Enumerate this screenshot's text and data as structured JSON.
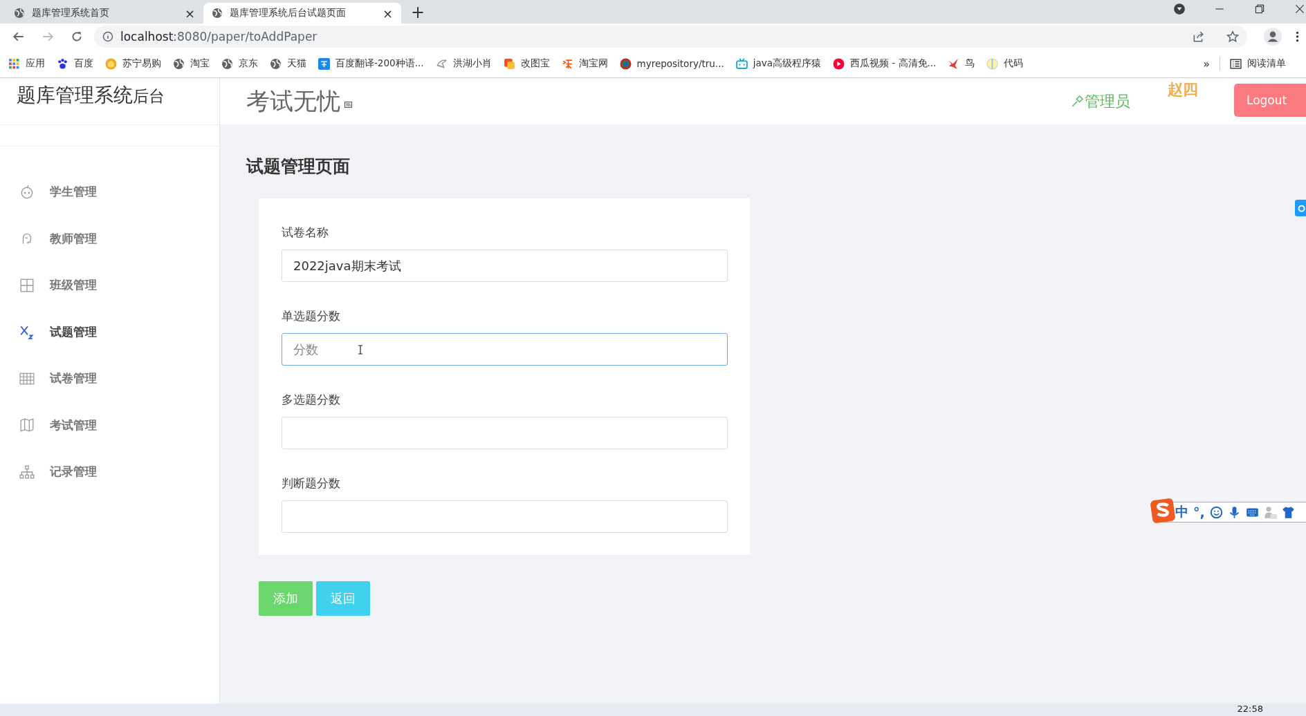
{
  "browser": {
    "tabs": [
      {
        "title": "题库管理系统首页",
        "selected": false,
        "close": "×"
      },
      {
        "title": "题库管理系统后台试题页面",
        "selected": true,
        "close": "×"
      }
    ],
    "new_tab": "+",
    "url_host": "localhost",
    "url_rest": ":8080/paper/toAddPaper",
    "bookmarks": [
      {
        "label": "应用",
        "kind": "apps"
      },
      {
        "label": "百度",
        "kind": "paw"
      },
      {
        "label": "苏宁易购",
        "kind": "lion"
      },
      {
        "label": "淘宝",
        "kind": "globe"
      },
      {
        "label": "京东",
        "kind": "globe"
      },
      {
        "label": "天猫",
        "kind": "globe"
      },
      {
        "label": "百度翻译-200种语...",
        "kind": "translate"
      },
      {
        "label": "洪湖小肖",
        "kind": "bird"
      },
      {
        "label": "改图宝",
        "kind": "square"
      },
      {
        "label": "淘宝网",
        "kind": "tao"
      },
      {
        "label": "myrepository/tru...",
        "kind": "ring"
      },
      {
        "label": "java高级程序猿",
        "kind": "tv"
      },
      {
        "label": "西瓜视频 - 高清免...",
        "kind": "play"
      },
      {
        "label": "鸟",
        "kind": "bird2"
      },
      {
        "label": "代码",
        "kind": "ball"
      }
    ],
    "more": "»",
    "reading_list": "阅读清单"
  },
  "header": {
    "brand": "题库管理系统",
    "brand_suffix": "后台",
    "logo": "考试无忧",
    "role": "管理员",
    "user": "赵四",
    "logout": "Logout"
  },
  "sidebar": {
    "items": [
      {
        "label": "学生管理",
        "selected": false
      },
      {
        "label": "教师管理",
        "selected": false
      },
      {
        "label": "班级管理",
        "selected": false
      },
      {
        "label": "试题管理",
        "selected": true
      },
      {
        "label": "试卷管理",
        "selected": false
      },
      {
        "label": "考试管理",
        "selected": false
      },
      {
        "label": "记录管理",
        "selected": false
      }
    ]
  },
  "page_title": "试题管理页面",
  "form": {
    "fields": [
      {
        "label": "试卷名称",
        "value": "2022java期末考试",
        "focused": false
      },
      {
        "label": "单选题分数",
        "placeholder": "分数",
        "focused": true
      },
      {
        "label": "多选题分数",
        "focused": false
      },
      {
        "label": "判断题分数",
        "focused": false
      }
    ]
  },
  "buttons": [
    {
      "label": "添加",
      "kind": "success"
    },
    {
      "label": "返回",
      "kind": "info"
    }
  ],
  "ime": {
    "mode": "中",
    "punct": "°,"
  },
  "taskbar": {
    "clock": "22:58"
  }
}
